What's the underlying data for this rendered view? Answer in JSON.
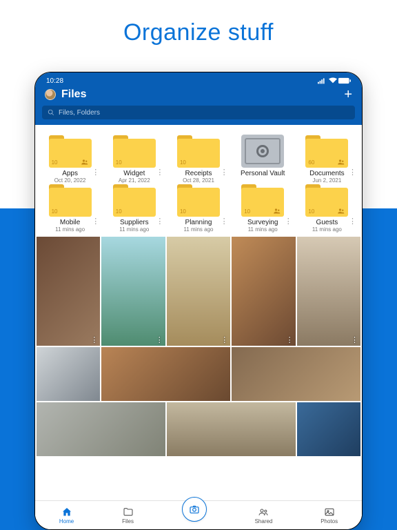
{
  "page": {
    "tagline": "Organize stuff"
  },
  "status": {
    "time": "10:28"
  },
  "header": {
    "title": "Files",
    "add": "+"
  },
  "search": {
    "placeholder": "Files, Folders"
  },
  "folders": [
    {
      "name": "Apps",
      "date": "Oct 20, 2022",
      "count": "10",
      "shared": true
    },
    {
      "name": "Widget",
      "date": "Apr 21, 2022",
      "count": "10",
      "shared": false
    },
    {
      "name": "Receipts",
      "date": "Oct 28, 2021",
      "count": "10",
      "shared": false
    },
    {
      "name": "Personal Vault",
      "date": "",
      "count": "",
      "vault": true
    },
    {
      "name": "Documents",
      "date": "Jun 2, 2021",
      "count": "60",
      "shared": true
    },
    {
      "name": "Mobile",
      "date": "11 mins ago",
      "count": "10",
      "shared": false
    },
    {
      "name": "Suppliers",
      "date": "11 mins ago",
      "count": "10",
      "shared": false
    },
    {
      "name": "Planning",
      "date": "11 mins ago",
      "count": "10",
      "shared": false
    },
    {
      "name": "Surveying",
      "date": "11 mins ago",
      "count": "10",
      "shared": true
    },
    {
      "name": "Guests",
      "date": "11 mins ago",
      "count": "10",
      "shared": true
    }
  ],
  "nav": {
    "home": "Home",
    "files": "Files",
    "shared": "Shared",
    "photos": "Photos"
  }
}
